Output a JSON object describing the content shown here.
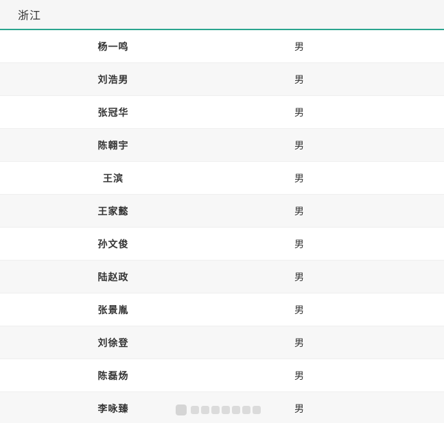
{
  "header": {
    "title": "浙江"
  },
  "rows": [
    {
      "name": "杨一鸣",
      "gender": "男"
    },
    {
      "name": "刘浩男",
      "gender": "男"
    },
    {
      "name": "张冠华",
      "gender": "男"
    },
    {
      "name": "陈翱宇",
      "gender": "男"
    },
    {
      "name": "王滨",
      "gender": "男"
    },
    {
      "name": "王家懿",
      "gender": "男"
    },
    {
      "name": "孙文俊",
      "gender": "男"
    },
    {
      "name": "陆赵政",
      "gender": "男"
    },
    {
      "name": "张景胤",
      "gender": "男"
    },
    {
      "name": "刘徐登",
      "gender": "男"
    },
    {
      "name": "陈磊炀",
      "gender": "男"
    },
    {
      "name": "李咏臻",
      "gender": "男"
    }
  ]
}
